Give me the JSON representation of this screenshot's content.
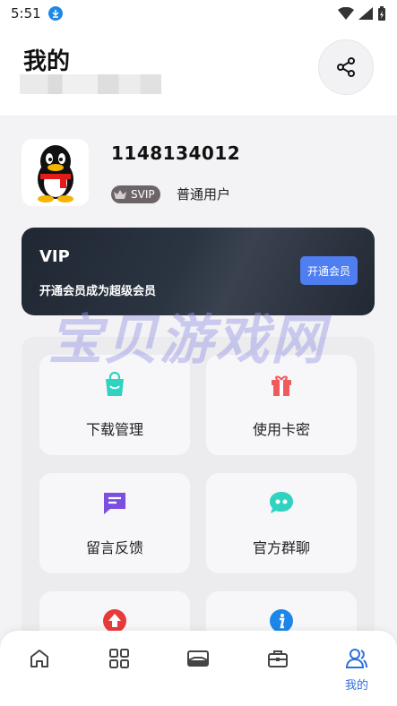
{
  "status_bar": {
    "time": "5:51"
  },
  "header": {
    "title": "我的"
  },
  "profile": {
    "user_id": "1148134012",
    "badge": "SVIP",
    "user_type": "普通用户"
  },
  "vip_banner": {
    "title": "VIP",
    "subtitle": "开通会员成为超级会员",
    "button": "开通会员"
  },
  "watermark": "宝贝游戏网",
  "grid": [
    {
      "label": "下载管理",
      "icon": "shopping-bag-icon",
      "color": "#2fd3c0"
    },
    {
      "label": "使用卡密",
      "icon": "gift-icon",
      "color": "#f05a5a"
    },
    {
      "label": "留言反馈",
      "icon": "message-icon",
      "color": "#7b4fe0"
    },
    {
      "label": "官方群聊",
      "icon": "chat-bubble-icon",
      "color": "#2fd3c0"
    },
    {
      "label": "",
      "icon": "upload-arrow-icon",
      "color": "#e93a3a"
    },
    {
      "label": "",
      "icon": "info-icon",
      "color": "#1d86e8"
    }
  ],
  "bottom_nav": {
    "items": [
      {
        "icon": "home-icon",
        "label": ""
      },
      {
        "icon": "apps-grid-icon",
        "label": ""
      },
      {
        "icon": "mail-icon",
        "label": ""
      },
      {
        "icon": "briefcase-icon",
        "label": ""
      },
      {
        "icon": "user-profile-icon",
        "label": "我的",
        "active": true
      }
    ]
  },
  "colors": {
    "accent": "#2f6fe0",
    "vip_button": "#4f7ef0",
    "banner": "#222833"
  }
}
